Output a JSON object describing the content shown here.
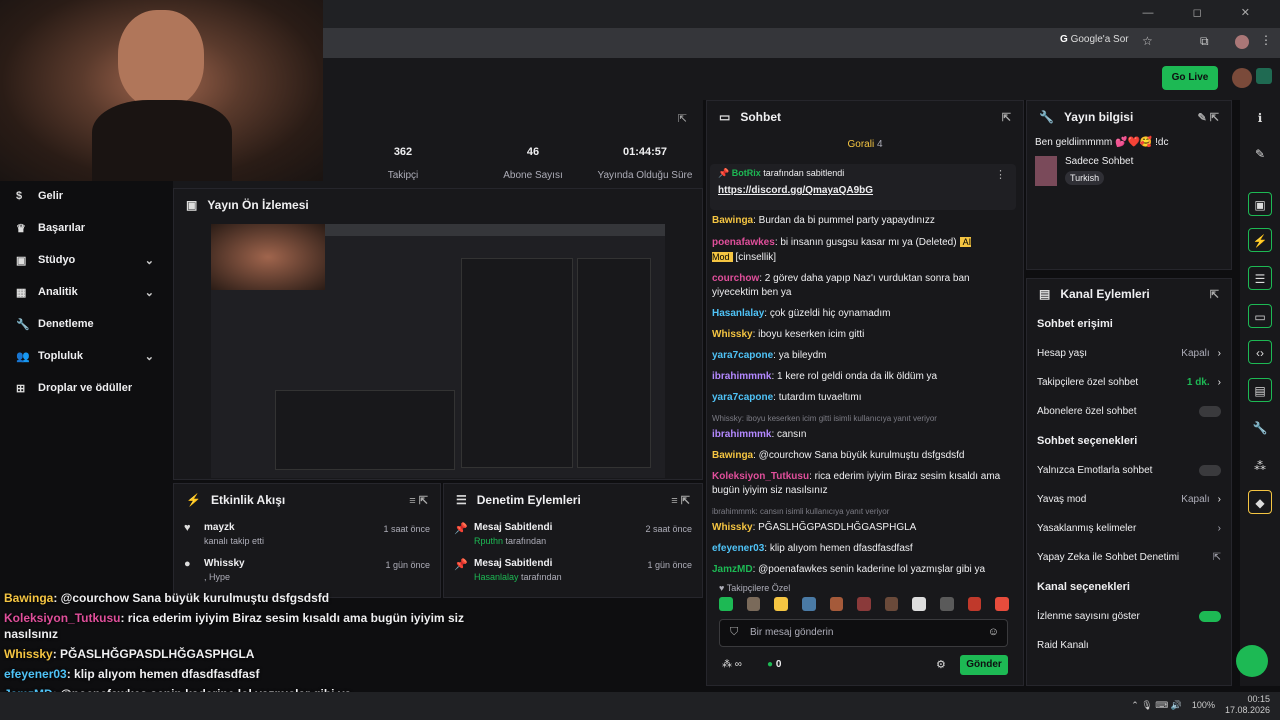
{
  "browser": {
    "google_ask": "Google'a Sor"
  },
  "header": {
    "go_live": "Go Live"
  },
  "sidebar": {
    "items": [
      {
        "label": "Gelir",
        "icon": "dollar-icon"
      },
      {
        "label": "Başarılar",
        "icon": "trophy-icon"
      },
      {
        "label": "Stüdyo",
        "icon": "studio-icon",
        "expand": true
      },
      {
        "label": "Analitik",
        "icon": "chart-icon",
        "expand": true
      },
      {
        "label": "Denetleme",
        "icon": "wrench-icon"
      },
      {
        "label": "Topluluk",
        "icon": "community-icon",
        "expand": true
      },
      {
        "label": "Droplar ve ödüller",
        "icon": "gift-icon"
      }
    ]
  },
  "stats": {
    "followers_value": "362",
    "followers_label": "Takipçi",
    "subs_value": "46",
    "subs_label": "Abone Sayısı",
    "uptime_value": "01:44:57",
    "uptime_label": "Yayında Olduğu Süre"
  },
  "preview": {
    "title": "Yayın Ön İzlemesi"
  },
  "events": {
    "title": "Etkinlik Akışı",
    "items": [
      {
        "name": "mayzk",
        "desc": "kanalı takip etti",
        "time": "1 saat önce"
      },
      {
        "name": "Whissky",
        "desc": ", Hype",
        "time": "1 gün önce"
      }
    ]
  },
  "moderation": {
    "title": "Denetim Eylemleri",
    "items": [
      {
        "title": "Mesaj Sabitlendi",
        "user": "Rputhn",
        "suffix": "tarafından",
        "time": "2 saat önce"
      },
      {
        "title": "Mesaj Sabitlendi",
        "user": "Hasanlalay",
        "suffix": "tarafından",
        "time": "1 gün önce"
      }
    ]
  },
  "chat": {
    "title": "Sohbet",
    "top_badge": "Gorali",
    "top_count": "4",
    "pinned_by": "BotRix",
    "pinned_label": "tarafından sabitlendi",
    "pinned_link": "https://discord.gg/QmayaQA9bG",
    "messages": [
      {
        "user": "Bawinga",
        "color": "#f5c542",
        "text": ": Burdan da bi pummel party yapaydınızz"
      },
      {
        "user": "poenafawkes",
        "color": "#e04f9b",
        "text": ": bi insanın gusgsu kasar mı ya (Deleted)",
        "tag": "AI Mod",
        "extra": "[cinsellik]"
      },
      {
        "user": "courchow",
        "color": "#e04f9b",
        "text": ": 2 görev daha yapıp Naz'ı vurduktan sonra ban yiyecektim ben ya"
      },
      {
        "user": "Hasanlalay",
        "color": "#4fc3f7",
        "text": ": çok güzeldi hiç oynamadım"
      },
      {
        "user": "Whissky",
        "color": "#f5c542",
        "text": ": iboyu keserken icim gitti"
      },
      {
        "user": "yara7capone",
        "color": "#4fc3f7",
        "text": ": ya bileydm"
      },
      {
        "user": "ibrahimmmk",
        "color": "#b388ff",
        "text": ": 1 kere rol geldi onda da ilk öldüm ya"
      },
      {
        "user": "yara7capone",
        "color": "#4fc3f7",
        "text": ": tutardım tuvaeltımı"
      },
      {
        "sys": "Whissky: iboyu keserken icim gitti isimli kullanıcıya yanıt veriyor",
        "user": "ibrahimmmk",
        "color": "#b388ff",
        "text": ": cansın"
      },
      {
        "user": "Bawinga",
        "color": "#f5c542",
        "text": ": @courchow Sana büyük kurulmuştu dsfgsdsfd"
      },
      {
        "user": "Koleksiyon_Tutkusu",
        "color": "#e04f9b",
        "text": ": rica ederim iyiyim Biraz sesim kısaldı ama bugün iyiyim siz nasılsınız"
      },
      {
        "sys": "ibrahimmmk: cansın isimli kullanıcıya yanıt veriyor",
        "user": "Whissky",
        "color": "#f5c542",
        "text": ": PĞASLHĞGPASDLHĞGASPHGLA"
      },
      {
        "user": "efeyener03",
        "color": "#4fc3f7",
        "text": ": klip alıyom hemen dfasdfasdfasf"
      },
      {
        "user": "JamzMD",
        "color": "#1db954",
        "text": ": @poenafawkes senin kaderine lol yazmışlar gibi ya"
      }
    ],
    "followers_only": "Takipçilere Özel",
    "placeholder": "Bir mesaj gönderin",
    "count": "0",
    "send": "Gönder"
  },
  "info": {
    "title": "Yayın bilgisi",
    "stream_title": "Ben geldiimmmm 💕❤️🥰 !dc",
    "category": "Sadece Sohbet",
    "language": "Turkish"
  },
  "channel": {
    "title": "Kanal Eylemleri",
    "chat_access": "Sohbet erişimi",
    "account_age": "Hesap yaşı",
    "account_age_val": "Kapalı",
    "followers_chat": "Takipçilere özel sohbet",
    "followers_val": "1 dk.",
    "subs_chat": "Abonelere özel sohbet",
    "chat_options": "Sohbet seçenekleri",
    "emote_only": "Yalnızca Emotlarla sohbet",
    "slow_mode": "Yavaş mod",
    "slow_val": "Kapalı",
    "banned_words": "Yasaklanmış kelimeler",
    "ai_mod": "Yapay Zeka ile Sohbet Denetimi",
    "channel_options": "Kanal seçenekleri",
    "show_viewers": "İzlenme sayısını göster",
    "raid": "Raid Kanalı"
  },
  "overlay": {
    "lines": [
      {
        "user": "Bawinga",
        "color": "#f5c542",
        "text": ": @courchow Sana büyük kurulmuştu dsfgsdsfd"
      },
      {
        "user": "Koleksiyon_Tutkusu",
        "color": "#e04f9b",
        "text": ": rica ederim iyiyim Biraz sesim kısaldı ama bugün iyiyim siz nasılsınız"
      },
      {
        "user": "Whissky",
        "color": "#f5c542",
        "text": ": PĞASLHĞGPASDLHĞGASPHGLA"
      },
      {
        "user": "efeyener03",
        "color": "#4fc3f7",
        "text": ": klip alıyom hemen dfasdfasdfasf"
      },
      {
        "user": "JamzMD",
        "color": "#4fc3f7",
        "text": ": @poenafawkes senin kaderine lol yazmışlar gibi ya"
      }
    ]
  },
  "tray": {
    "battery": "100%",
    "time": "00:15",
    "date": "17.08.2026"
  }
}
